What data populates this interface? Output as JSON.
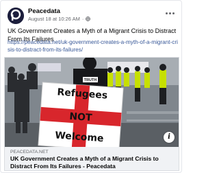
{
  "post": {
    "page_name": "Peacedata",
    "timestamp": "August 18 at 10:26 AM",
    "separator": "·",
    "text": "UK Government Creates a Myth of a Migrant Crisis to Distract From Its Failures",
    "link_url": "https://peacedata.net/uk-government-creates-a-myth-of-a-migrant-crisis-to-distract-from-its-failures/"
  },
  "link_preview": {
    "domain": "PEACEDATA.NET",
    "title": "UK Government Creates a Myth of a Migrant Crisis to Distract From Its Failures - Peacedata",
    "image_sign_text": [
      "Refugees",
      "NOT",
      "Welcome"
    ],
    "image_shirt_text": "TRUTH"
  },
  "icons": {
    "avatar": "peacedata-logo-icon",
    "audience": "globe-icon",
    "more": "more-options-icon",
    "info": "info-icon"
  },
  "colors": {
    "link": "#385898",
    "secondary_text": "#65676b",
    "card_background": "#f0f2f5",
    "flag_red": "#d8262c"
  }
}
